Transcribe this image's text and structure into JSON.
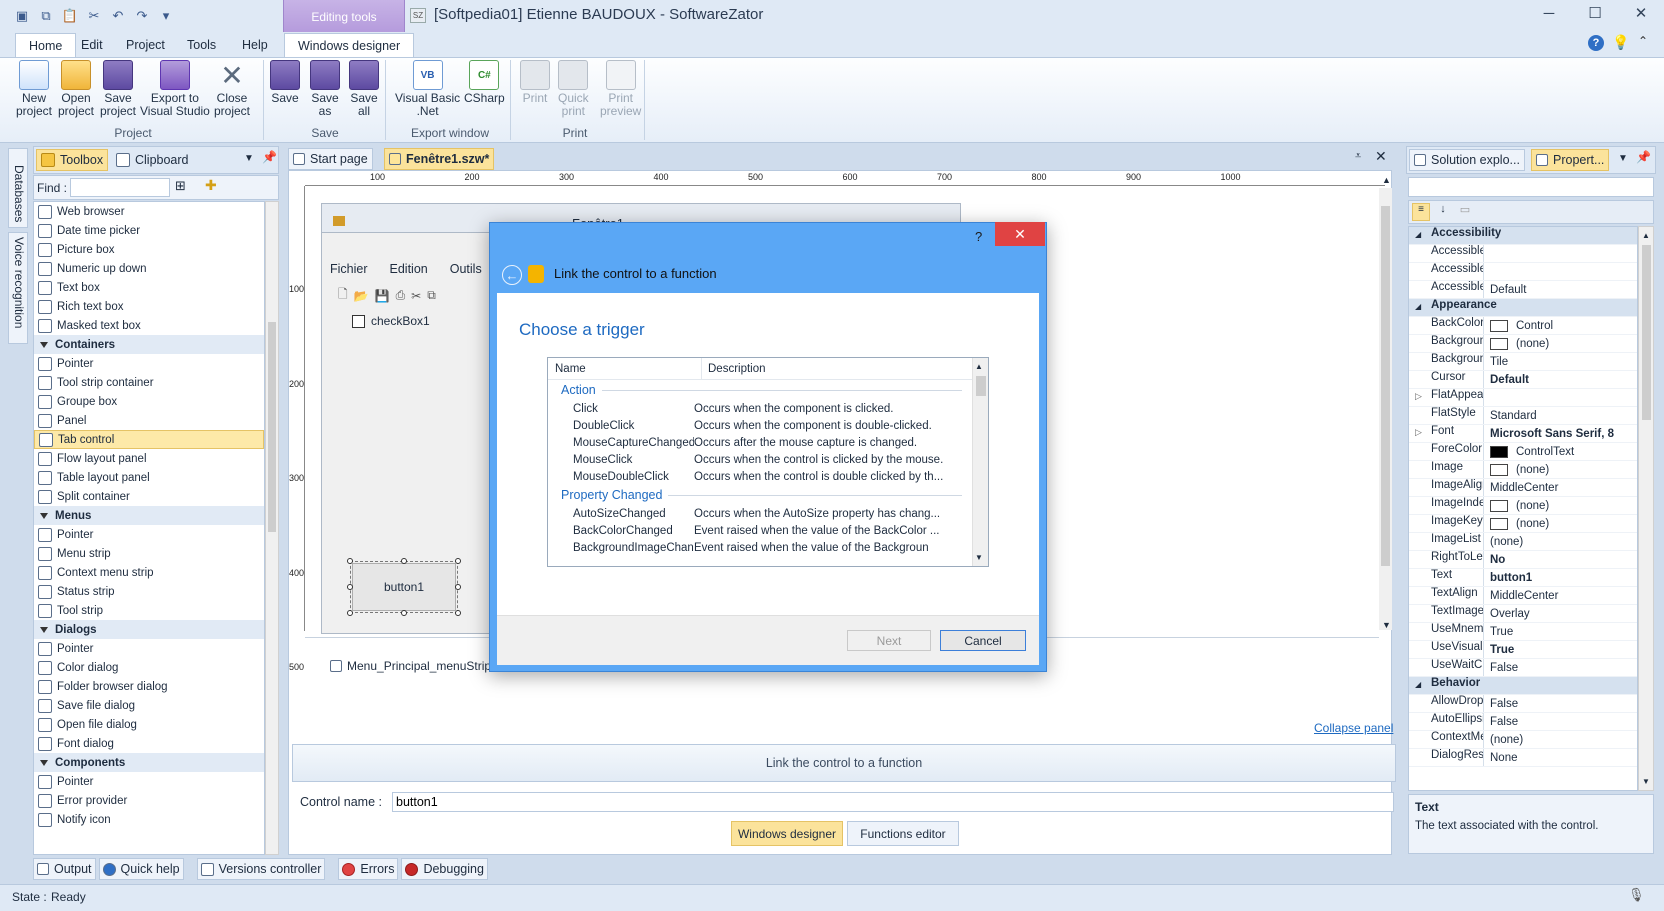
{
  "window": {
    "title": "[Softpedia01] Etienne BAUDOUX - SoftwareZator",
    "context_tab_group": "Editing tools",
    "app_badge": "SZ"
  },
  "menu": {
    "tabs": [
      "Home",
      "Edit",
      "Project",
      "Tools",
      "Help"
    ],
    "context_tab": "Windows designer"
  },
  "ribbon": {
    "project": {
      "label": "Project",
      "buttons": [
        {
          "line1": "New",
          "line2": "project"
        },
        {
          "line1": "Open",
          "line2": "project"
        },
        {
          "line1": "Save",
          "line2": "project"
        },
        {
          "line1": "Export to",
          "line2": "Visual Studio"
        },
        {
          "line1": "Close",
          "line2": "project"
        }
      ]
    },
    "save": {
      "label": "Save",
      "buttons": [
        {
          "line1": "Save",
          "line2": ""
        },
        {
          "line1": "Save",
          "line2": "as"
        },
        {
          "line1": "Save",
          "line2": "all"
        }
      ]
    },
    "export": {
      "label": "Export window",
      "buttons": [
        {
          "line1": "Visual Basic",
          "line2": ".Net",
          "icon_text": "VB"
        },
        {
          "line1": "CSharp",
          "line2": "",
          "icon_text": "C#"
        }
      ]
    },
    "print": {
      "label": "Print",
      "buttons": [
        {
          "line1": "Print",
          "line2": ""
        },
        {
          "line1": "Quick",
          "line2": "print"
        },
        {
          "line1": "Print",
          "line2": "preview"
        }
      ]
    }
  },
  "side_tabs": [
    "Databases",
    "Voice recognition"
  ],
  "toolbox": {
    "tabs": [
      "Toolbox",
      "Clipboard"
    ],
    "find_label": "Find :",
    "find_value": "",
    "items": [
      {
        "label": "Web browser",
        "type": "item"
      },
      {
        "label": "Date time picker",
        "type": "item"
      },
      {
        "label": "Picture box",
        "type": "item"
      },
      {
        "label": "Numeric up down",
        "type": "item"
      },
      {
        "label": "Text box",
        "type": "item"
      },
      {
        "label": "Rich text box",
        "type": "item"
      },
      {
        "label": "Masked text box",
        "type": "item"
      },
      {
        "label": "Containers",
        "type": "cat"
      },
      {
        "label": "Pointer",
        "type": "item"
      },
      {
        "label": "Tool strip container",
        "type": "item"
      },
      {
        "label": "Groupe box",
        "type": "item"
      },
      {
        "label": "Panel",
        "type": "item"
      },
      {
        "label": "Tab control",
        "type": "sel"
      },
      {
        "label": "Flow layout panel",
        "type": "item"
      },
      {
        "label": "Table layout panel",
        "type": "item"
      },
      {
        "label": "Split container",
        "type": "item"
      },
      {
        "label": "Menus",
        "type": "cat"
      },
      {
        "label": "Pointer",
        "type": "item"
      },
      {
        "label": "Menu strip",
        "type": "item"
      },
      {
        "label": "Context menu strip",
        "type": "item"
      },
      {
        "label": "Status strip",
        "type": "item"
      },
      {
        "label": "Tool strip",
        "type": "item"
      },
      {
        "label": "Dialogs",
        "type": "cat"
      },
      {
        "label": "Pointer",
        "type": "item"
      },
      {
        "label": "Color dialog",
        "type": "item"
      },
      {
        "label": "Folder browser dialog",
        "type": "item"
      },
      {
        "label": "Save file dialog",
        "type": "item"
      },
      {
        "label": "Open file dialog",
        "type": "item"
      },
      {
        "label": "Font dialog",
        "type": "item"
      },
      {
        "label": "Components",
        "type": "cat"
      },
      {
        "label": "Pointer",
        "type": "item"
      },
      {
        "label": "Error provider",
        "type": "item"
      },
      {
        "label": "Notify icon",
        "type": "item"
      }
    ]
  },
  "document_tabs": [
    "Start page",
    "Fenêtre1.szw*"
  ],
  "ruler": {
    "h_ticks": [
      "100",
      "200",
      "300",
      "400",
      "500",
      "600",
      "700",
      "800",
      "900",
      "1000"
    ],
    "v_ticks": [
      "100",
      "200",
      "300",
      "400",
      "500"
    ]
  },
  "designed_form": {
    "title": "Fenêtre1",
    "menu": [
      "Fichier",
      "Edition",
      "Outils"
    ],
    "checkbox_label": "checkBox1",
    "button_label": "button1",
    "component_tray_item": "Menu_Principal_menuStrip"
  },
  "dialog": {
    "header": "Link the control to a function",
    "heading": "Choose a trigger",
    "columns": [
      "Name",
      "Description"
    ],
    "groups": [
      {
        "name": "Action",
        "rows": [
          {
            "name": "Click",
            "desc": "Occurs when the component is clicked."
          },
          {
            "name": "DoubleClick",
            "desc": "Occurs when the component is double-clicked."
          },
          {
            "name": "MouseCaptureChanged",
            "desc": "Occurs after the mouse capture is changed."
          },
          {
            "name": "MouseClick",
            "desc": "Occurs when the control is clicked by the mouse."
          },
          {
            "name": "MouseDoubleClick",
            "desc": "Occurs when the control is double clicked by th..."
          }
        ]
      },
      {
        "name": "Property Changed",
        "rows": [
          {
            "name": "AutoSizeChanged",
            "desc": "Occurs when the AutoSize property has chang..."
          },
          {
            "name": "BackColorChanged",
            "desc": "Event raised when the value of the BackColor ..."
          },
          {
            "name": "BackgroundImageChan",
            "desc": "Event raised when the value of the Backgroun"
          }
        ]
      }
    ],
    "next_label": "Next",
    "cancel_label": "Cancel"
  },
  "bottom_panel": {
    "collapse_link": "Collapse panel",
    "link_bar": "Link the control to a function",
    "control_name_label": "Control name :",
    "control_name_value": "button1",
    "windows_designer_btn": "Windows designer",
    "functions_editor_btn": "Functions editor"
  },
  "right_panel": {
    "tabs": [
      "Solution explo...",
      "Propert..."
    ],
    "search_value": "",
    "properties": [
      {
        "name": "Accessibility",
        "cat": true
      },
      {
        "name": "AccessibleDes",
        "value": ""
      },
      {
        "name": "AccessibleNar",
        "value": ""
      },
      {
        "name": "AccessibleRol",
        "value": "Default"
      },
      {
        "name": "Appearance",
        "cat": true
      },
      {
        "name": "BackColor",
        "value": "Control",
        "swatch": "#ffffff"
      },
      {
        "name": "BackgroundIn",
        "value": "(none)",
        "swatch": "#ffffff"
      },
      {
        "name": "BackgroundIn",
        "value": "Tile"
      },
      {
        "name": "Cursor",
        "value": "Default",
        "bold": true
      },
      {
        "name": "FlatAppearanc",
        "value": "",
        "expand": true
      },
      {
        "name": "FlatStyle",
        "value": "Standard"
      },
      {
        "name": "Font",
        "value": "Microsoft Sans Serif, 8",
        "bold": true,
        "expand": true
      },
      {
        "name": "ForeColor",
        "value": "ControlText",
        "swatch": "#000000"
      },
      {
        "name": "Image",
        "value": "(none)",
        "swatch": "#ffffff"
      },
      {
        "name": "ImageAlign",
        "value": "MiddleCenter"
      },
      {
        "name": "ImageIndex",
        "value": "(none)",
        "swatch": "#ffffff"
      },
      {
        "name": "ImageKey",
        "value": "(none)",
        "swatch": "#ffffff"
      },
      {
        "name": "ImageList",
        "value": "(none)"
      },
      {
        "name": "RightToLeft",
        "value": "No",
        "bold": true
      },
      {
        "name": "Text",
        "value": "button1",
        "bold": true
      },
      {
        "name": "TextAlign",
        "value": "MiddleCenter"
      },
      {
        "name": "TextImageRela",
        "value": "Overlay"
      },
      {
        "name": "UseMnemonic",
        "value": "True"
      },
      {
        "name": "UseVisualStyle",
        "value": "True",
        "bold": true
      },
      {
        "name": "UseWaitCurso",
        "value": "False"
      },
      {
        "name": "Behavior",
        "cat": true
      },
      {
        "name": "AllowDrop",
        "value": "False"
      },
      {
        "name": "AutoEllipsis",
        "value": "False"
      },
      {
        "name": "ContextMenuS",
        "value": "(none)"
      },
      {
        "name": "DialogResult",
        "value": "None"
      }
    ],
    "help_title": "Text",
    "help_desc": "The text associated with the control."
  },
  "bottom_tabs": [
    "Output",
    "Quick help",
    "Versions controller",
    "Errors",
    "Debugging"
  ],
  "status": {
    "label": "State :",
    "value": "Ready"
  },
  "colors": {
    "accent": "#1e6ac1",
    "dialog_header": "#5aa7f5",
    "close_red": "#e04343",
    "active_tab": "#fbe39b",
    "context_tab": "#b59ddd"
  }
}
